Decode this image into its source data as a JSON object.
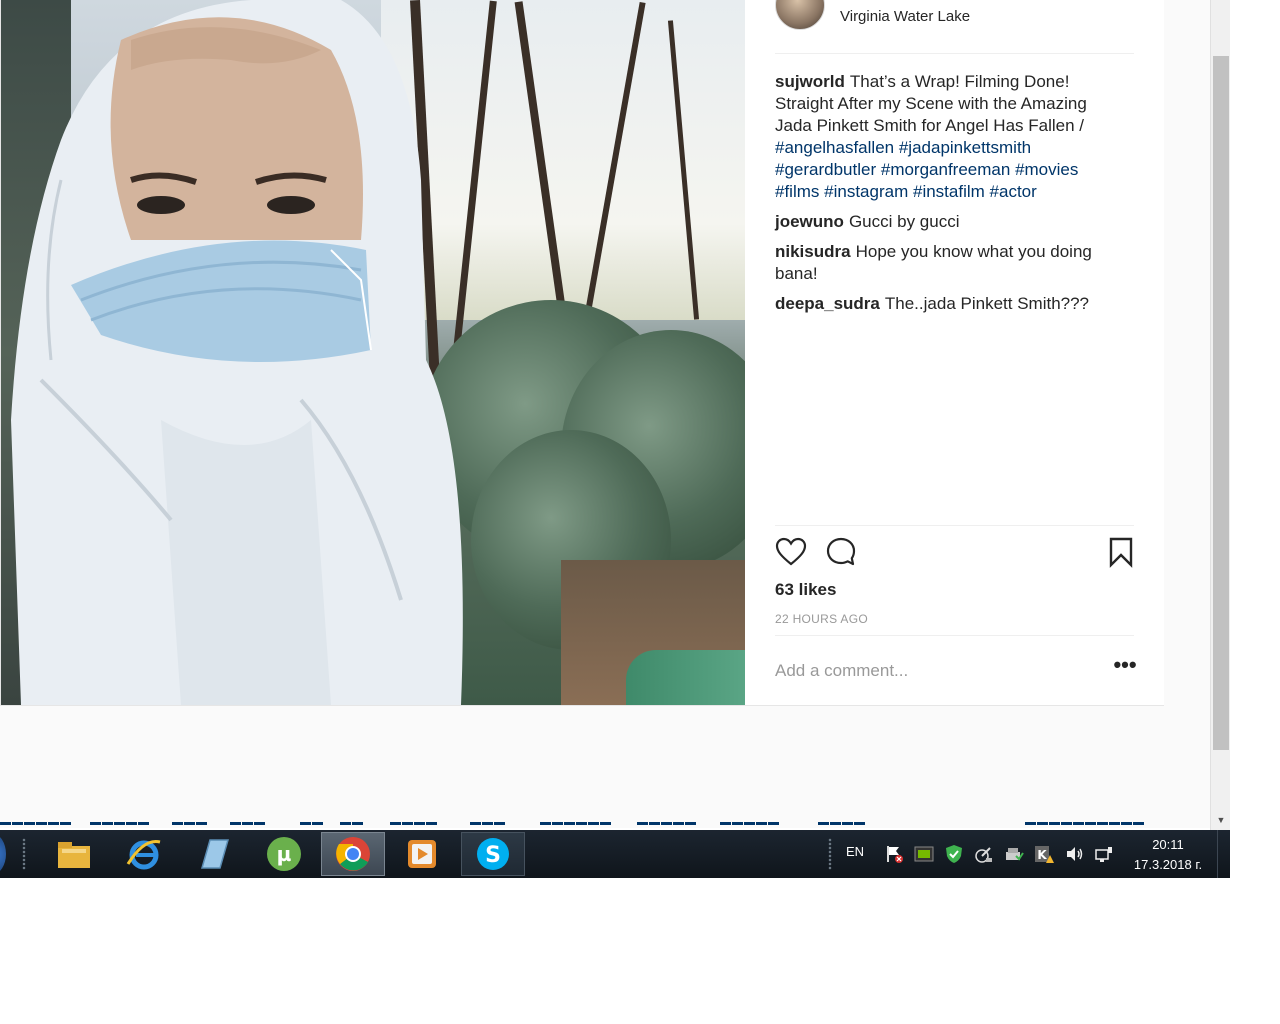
{
  "post": {
    "location": "Virginia Water Lake",
    "comments": [
      {
        "user": "sujworld",
        "text": "That’s a Wrap! Filming Done! Straight After my Scene with the Amazing Jada Pinkett Smith for Angel Has Fallen /",
        "hashtags": [
          "#angelhasfallen",
          "#jadapinkettsmith",
          "#gerardbutler",
          "#morganfreeman",
          "#movies",
          "#films",
          "#instagram",
          "#instafilm",
          "#actor"
        ]
      },
      {
        "user": "joewuno",
        "text": "Gucci by gucci"
      },
      {
        "user": "nikisudra",
        "text": "Hope you know what you doing bana!"
      },
      {
        "user": "deepa_sudra",
        "text": "The..jada Pinkett Smith???"
      }
    ],
    "likes": "63 likes",
    "time_ago": "22 HOURS AGO",
    "comment_placeholder": "Add a comment...",
    "more_options": "•••",
    "icons": [
      "heart-icon",
      "comment-icon",
      "bookmark-icon"
    ]
  },
  "scrollbar": {
    "down_arrow": "▼"
  },
  "taskbar": {
    "apps": [
      "file-explorer-icon",
      "internet-explorer-icon",
      "notepad-icon",
      "utorrent-icon",
      "chrome-icon",
      "media-player-icon",
      "skype-icon"
    ],
    "language": "EN",
    "time": "20:11",
    "date": "17.3.2018 г."
  }
}
